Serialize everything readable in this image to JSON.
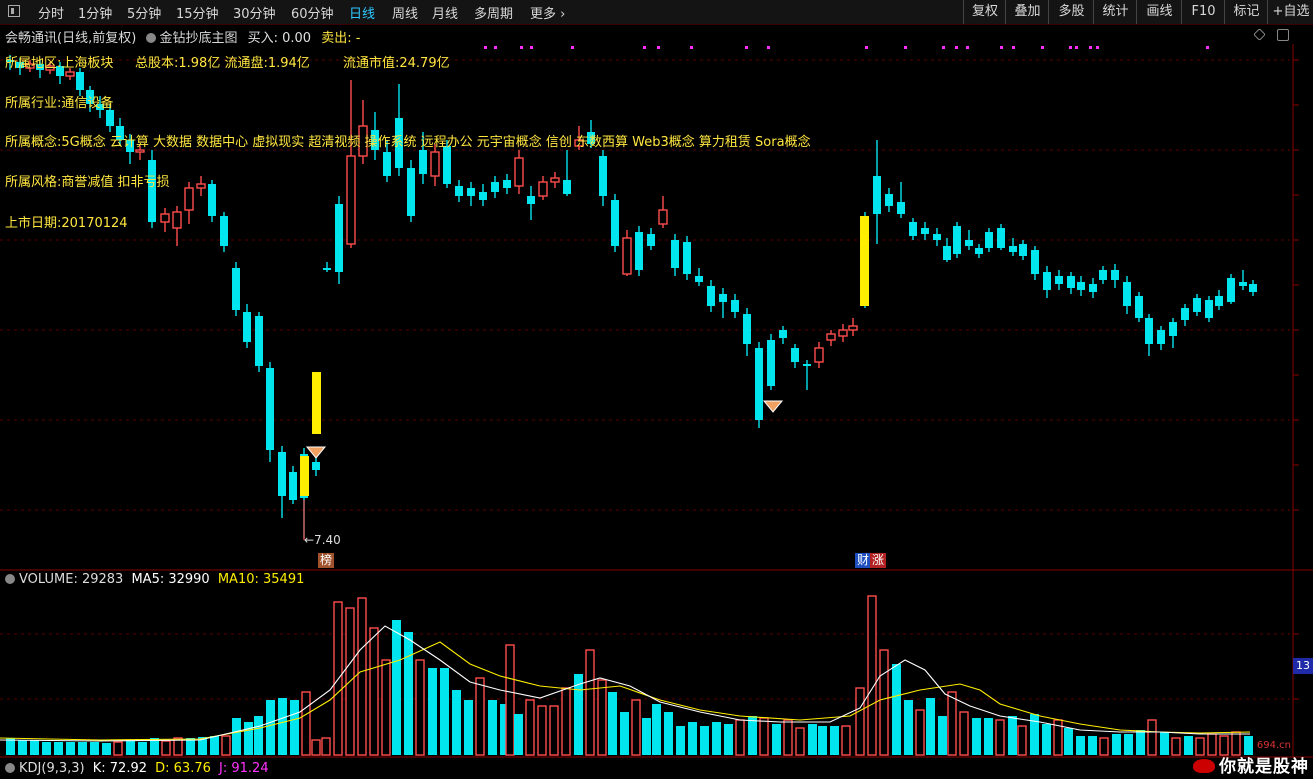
{
  "toolbar": {
    "periods": [
      "分时",
      "1分钟",
      "5分钟",
      "15分钟",
      "30分钟",
      "60分钟",
      "日线",
      "周线",
      "月线",
      "多周期",
      "更多"
    ],
    "active_period": "日线",
    "right_buttons": [
      "复权",
      "叠加",
      "多股",
      "统计",
      "画线",
      "F10",
      "标记",
      "+自选"
    ]
  },
  "main": {
    "stock_name": "会畅通讯",
    "chart_mode": "(日线,前复权)",
    "indicator_name": "金钻抄底主图",
    "buy_label": "买入: 0.00",
    "sell_label": "卖出: -",
    "info_lines": {
      "region": "所属地区:上海板块",
      "share_capital": "总股本:1.98亿 流通盘:1.94亿",
      "float_mkt_cap": "流通市值:24.79亿",
      "industry": "所属行业:通信设备",
      "concepts": "所属概念:5G概念 云计算 大数据 数据中心 虚拟现实 超清视频 操作系统 远程办公 元宇宙概念 信创 东数西算 Web3概念 算力租赁 Sora概念",
      "style": "所属风格:商誉减值 扣非亏损",
      "listing_date": "上市日期:20170124"
    },
    "low_price_label": "←7.40",
    "markers": [
      "榜",
      "财",
      "涨"
    ]
  },
  "volume_panel": {
    "label": "VOLUME: 29283",
    "ma5": "MA5: 32990",
    "ma10": "MA10: 35491",
    "right_badge": "13"
  },
  "kdj_panel": {
    "label": "KDJ(9,3,3)",
    "k": "K: 72.92",
    "d": "D: 63.76",
    "j": "J: 91.24"
  },
  "watermark": {
    "text": "你就是股神",
    "site": "694.cn"
  },
  "colors": {
    "up": "#ff4d4d",
    "down": "#00e5ee",
    "signal": "#ffee00",
    "ma5": "#ffffff",
    "ma10": "#ffee00",
    "active": "#2ec7ff",
    "text_info": "#ffe640"
  }
}
